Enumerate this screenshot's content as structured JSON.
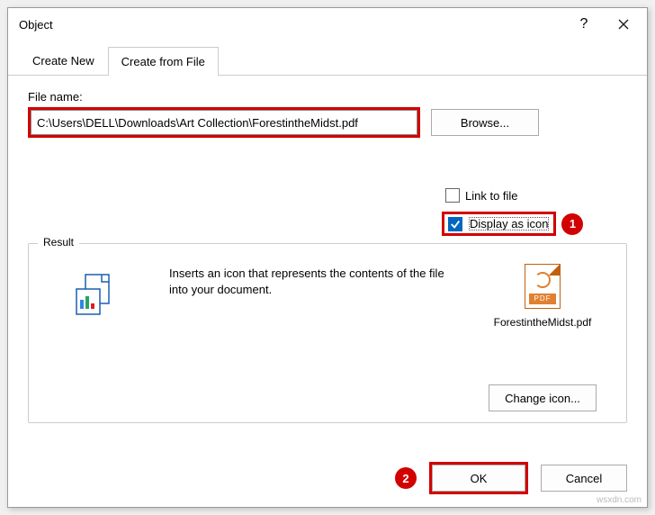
{
  "window": {
    "title": "Object",
    "help_icon": "?",
    "close_icon": "✕"
  },
  "tabs": {
    "create_new": "Create New",
    "create_from_file": "Create from File"
  },
  "file": {
    "label": "File name:",
    "value": "C:\\Users\\DELL\\Downloads\\Art Collection\\ForestintheMidst.pdf",
    "browse_label": "Browse..."
  },
  "options": {
    "link_label": "Link to file",
    "display_icon_label": "Display as icon"
  },
  "result": {
    "legend": "Result",
    "description": "Inserts an icon that represents the contents of the file into your document.",
    "preview_name": "ForestintheMidst.pdf",
    "pdf_badge": "PDF",
    "change_icon_label": "Change icon..."
  },
  "footer": {
    "ok_label": "OK",
    "cancel_label": "Cancel"
  },
  "badges": {
    "one": "1",
    "two": "2"
  },
  "watermark": "wsxdn.com"
}
